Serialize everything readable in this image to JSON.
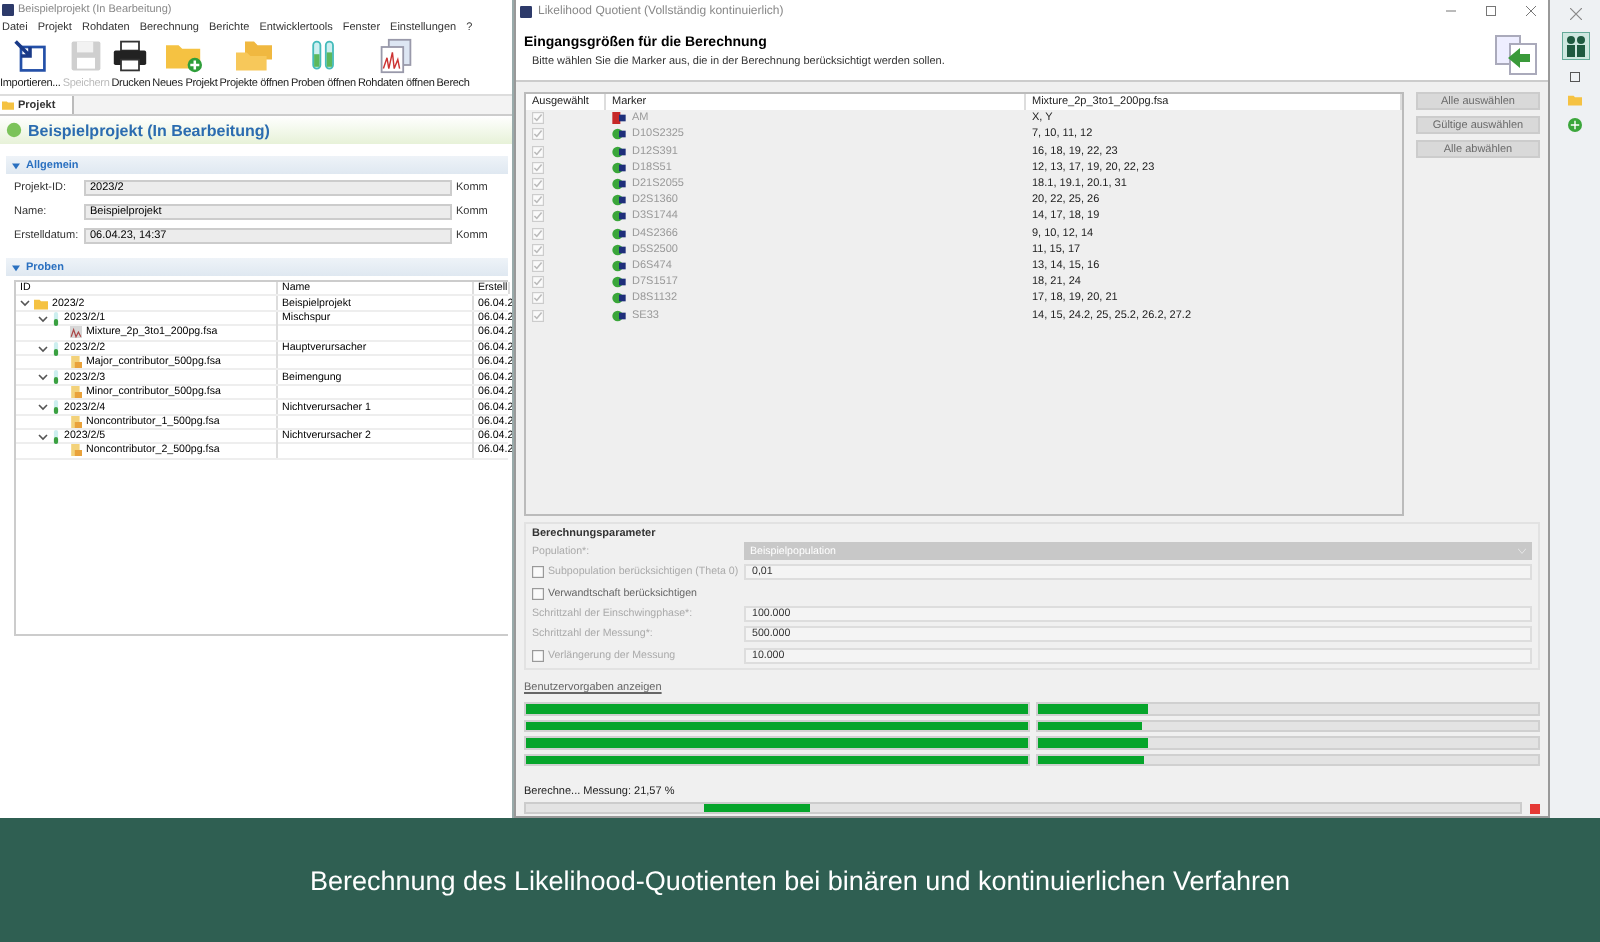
{
  "app": {
    "title": "Beispielprojekt (In Bearbeitung)",
    "menu": [
      "Datei",
      "Projekt",
      "Rohdaten",
      "Berechnung",
      "Berichte",
      "Entwicklertools",
      "Fenster",
      "Einstellungen",
      "?"
    ],
    "toolbar": [
      {
        "label": "Importieren...",
        "kind": "import",
        "disabled": false
      },
      {
        "label": "Speichern",
        "kind": "save",
        "disabled": true
      },
      {
        "label": "Drucken",
        "kind": "print",
        "disabled": false
      },
      {
        "label": "Neues Projekt",
        "kind": "new_project",
        "disabled": false
      },
      {
        "label": "Projekte öffnen",
        "kind": "open_projects",
        "disabled": false
      },
      {
        "label": "Proben öffnen",
        "kind": "open_samples",
        "disabled": false
      },
      {
        "label": "Rohdaten öffnen",
        "kind": "open_raw",
        "disabled": false
      },
      {
        "label": "Berech",
        "kind": "cut",
        "disabled": false
      }
    ],
    "tabs": [
      {
        "label": "Projekt",
        "selected": true
      }
    ],
    "project_header": "Beispielprojekt (In Bearbeitung)",
    "general": {
      "title": "Allgemein",
      "expanded": true,
      "fields": [
        {
          "label": "Projekt-ID:",
          "value": "2023/2",
          "side_label": "Komm"
        },
        {
          "label": "Name:",
          "value": "Beispielprojekt",
          "side_label": "Komm"
        },
        {
          "label": "Erstelldatum:",
          "value": "06.04.23, 14:37",
          "side_label": "Komm"
        }
      ]
    },
    "samples": {
      "title": "Proben",
      "expanded": true,
      "columns": [
        "ID",
        "Name",
        "Erstell"
      ],
      "rows": [
        {
          "id": "2023/2",
          "name": "Beispielprojekt",
          "date": "06.04.2",
          "kind": "folder",
          "expanded": true,
          "children": [
            {
              "id": "2023/2/1",
              "name": "Mischspur",
              "date": "06.04.2",
              "kind": "sample",
              "expanded": true,
              "children": [
                {
                  "id": "Mixture_2p_3to1_200pg.fsa",
                  "date": "06.04.2",
                  "kind": "mixture_file"
                }
              ]
            },
            {
              "id": "2023/2/2",
              "name": "Hauptverursacher",
              "date": "06.04.2",
              "kind": "sample",
              "expanded": true,
              "children": [
                {
                  "id": "Major_contributor_500pg.fsa",
                  "date": "06.04.2",
                  "kind": "file"
                }
              ]
            },
            {
              "id": "2023/2/3",
              "name": "Beimengung",
              "date": "06.04.2",
              "kind": "sample",
              "expanded": true,
              "children": [
                {
                  "id": "Minor_contributor_500pg.fsa",
                  "date": "06.04.2",
                  "kind": "file"
                }
              ]
            },
            {
              "id": "2023/2/4",
              "name": "Nichtverursacher 1",
              "date": "06.04.2",
              "kind": "sample",
              "expanded": true,
              "children": [
                {
                  "id": "Noncontributor_1_500pg.fsa",
                  "date": "06.04.2",
                  "kind": "file"
                }
              ]
            },
            {
              "id": "2023/2/5",
              "name": "Nichtverursacher 2",
              "date": "06.04.2",
              "kind": "sample",
              "expanded": true,
              "children": [
                {
                  "id": "Noncontributor_2_500pg.fsa",
                  "date": "06.04.2",
                  "kind": "file"
                }
              ]
            }
          ]
        }
      ]
    }
  },
  "dialog": {
    "title": "Likelihood Quotient (Vollständig kontinuierlich)",
    "heading": "Eingangsgrößen für die Berechnung",
    "subtitle": "Bitte wählen Sie die Marker aus, die in der Berechnung berücksichtigt werden sollen.",
    "columns": [
      "Ausgewählt",
      "Marker",
      "Mixture_2p_3to1_200pg.fsa"
    ],
    "markers": [
      {
        "checked": true,
        "kind": "am",
        "marker": "AM",
        "alleles": "X, Y"
      },
      {
        "checked": true,
        "kind": "str",
        "marker": "D10S2325",
        "alleles": "7, 10, 11, 12"
      },
      {
        "checked": true,
        "kind": "str",
        "marker": "D12S391",
        "alleles": "16, 18, 19, 22, 23"
      },
      {
        "checked": true,
        "kind": "str",
        "marker": "D18S51",
        "alleles": "12, 13, 17, 19, 20, 22, 23"
      },
      {
        "checked": true,
        "kind": "str",
        "marker": "D21S2055",
        "alleles": "18.1, 19.1, 20.1, 31"
      },
      {
        "checked": true,
        "kind": "str",
        "marker": "D2S1360",
        "alleles": "20, 22, 25, 26"
      },
      {
        "checked": true,
        "kind": "str",
        "marker": "D3S1744",
        "alleles": "14, 17, 18, 19"
      },
      {
        "checked": true,
        "kind": "str",
        "marker": "D4S2366",
        "alleles": "9, 10, 12, 14"
      },
      {
        "checked": true,
        "kind": "str",
        "marker": "D5S2500",
        "alleles": "11, 15, 17"
      },
      {
        "checked": true,
        "kind": "str",
        "marker": "D6S474",
        "alleles": "13, 14, 15, 16"
      },
      {
        "checked": true,
        "kind": "str",
        "marker": "D7S1517",
        "alleles": "18, 21, 24"
      },
      {
        "checked": true,
        "kind": "str",
        "marker": "D8S1132",
        "alleles": "17, 18, 19, 20, 21"
      },
      {
        "checked": true,
        "kind": "str",
        "marker": "SE33",
        "alleles": "14, 15, 24.2, 25, 25.2, 26.2, 27.2"
      }
    ],
    "buttons": [
      {
        "label": "Alle auswählen",
        "disabled": true
      },
      {
        "label": "Gültige auswählen",
        "disabled": true
      },
      {
        "label": "Alle abwählen",
        "disabled": true
      }
    ],
    "params": {
      "title": "Berechnungsparameter",
      "rows": [
        {
          "kind": "select",
          "label": "Population*:",
          "value": "Beispielpopulation"
        },
        {
          "kind": "checkbox_field",
          "label": "Subpopulation berücksichtigen (Theta 0)",
          "checked": false,
          "value": "0,01"
        },
        {
          "kind": "checkbox",
          "label": "Verwandtschaft berücksichtigen",
          "checked": false
        },
        {
          "kind": "field",
          "label": "Schrittzahl der Einschwingphase*:",
          "value": "100.000"
        },
        {
          "kind": "field",
          "label": "Schrittzahl der Messung*:",
          "value": "500.000"
        },
        {
          "kind": "checkbox_field",
          "label": "Verlängerung der Messung",
          "checked": false,
          "value": "10.000"
        }
      ]
    },
    "link": "Benutzervorgaben anzeigen",
    "progress": [
      {
        "bars": [
          {
            "level": 1
          },
          {
            "level": 0.22
          }
        ]
      },
      {
        "bars": [
          {
            "level": 1
          },
          {
            "level": 0.21
          }
        ]
      },
      {
        "bars": [
          {
            "level": 1
          },
          {
            "level": 0.22
          }
        ]
      },
      {
        "bars": [
          {
            "level": 1
          },
          {
            "level": 0.215
          }
        ]
      }
    ],
    "status": "Berechne... Messung: 21,57 %"
  },
  "caption": "Berechnung des Likelihood-Quotienten bei binären und kontinuierlichen Verfahren"
}
